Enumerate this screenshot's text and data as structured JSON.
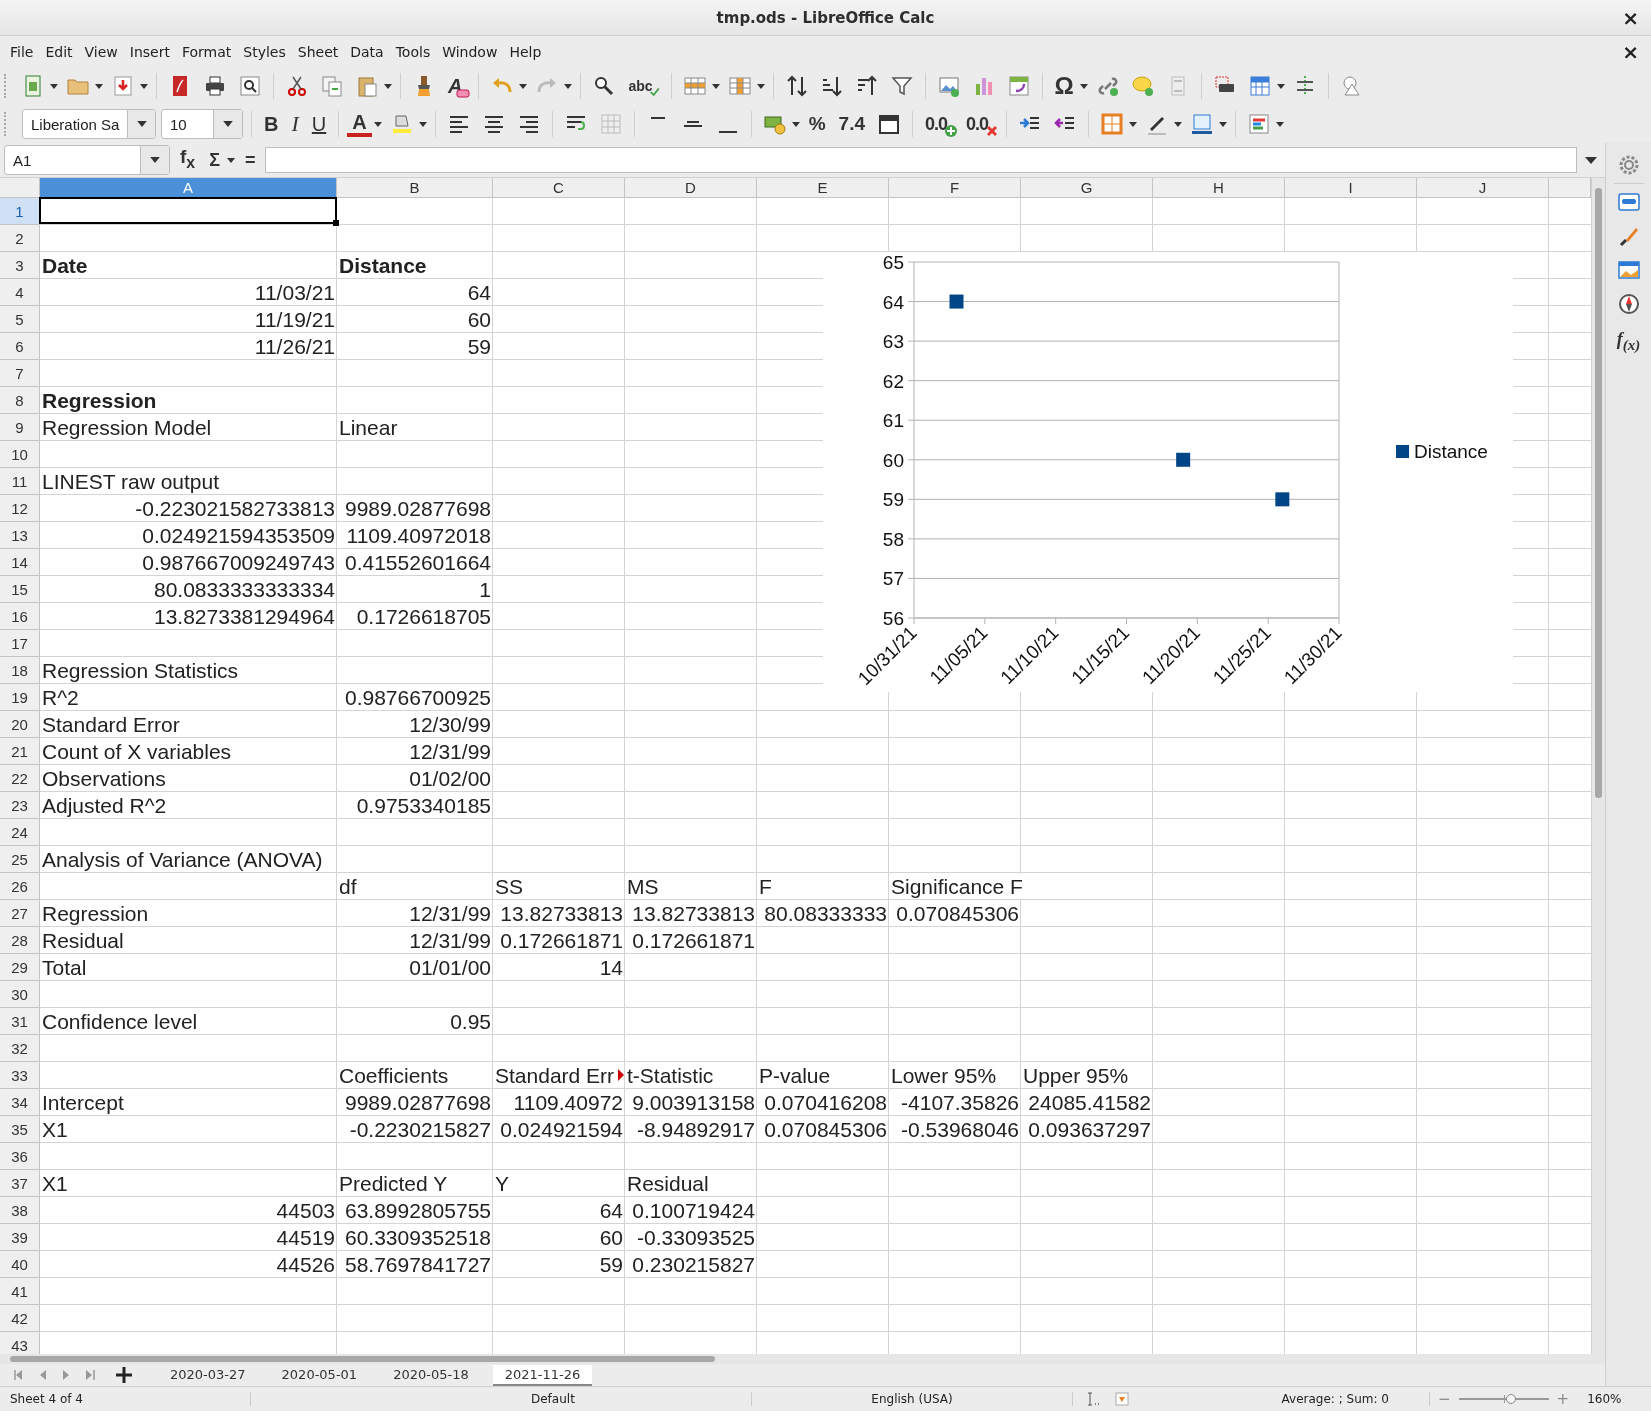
{
  "window": {
    "title": "tmp.ods - LibreOffice Calc",
    "close": "×"
  },
  "menu": {
    "items": [
      "File",
      "Edit",
      "View",
      "Insert",
      "Format",
      "Styles",
      "Sheet",
      "Data",
      "Tools",
      "Window",
      "Help"
    ],
    "close": "×"
  },
  "standard_toolbar": {
    "clear_formatting": "A",
    "spelling": "abc",
    "special_character": "Ω"
  },
  "formatting_toolbar": {
    "font_name": "Liberation Sa",
    "font_size": "10",
    "bold": "B",
    "italic": "I",
    "underline": "U",
    "font_color": "A",
    "percent": "%",
    "number": "7.4",
    "add_decimal": "0.0",
    "delete_decimal": "0.0"
  },
  "formula_bar": {
    "name_box": "A1",
    "function_wizard": "f$_{x}$",
    "sum": "Σ",
    "equals": "="
  },
  "sheet": {
    "columns": [
      {
        "label": "A",
        "selected": true
      },
      {
        "label": "B",
        "selected": false
      },
      {
        "label": "C",
        "selected": false
      },
      {
        "label": "D",
        "selected": false
      },
      {
        "label": "E",
        "selected": false
      },
      {
        "label": "F",
        "selected": false
      },
      {
        "label": "G",
        "selected": false
      },
      {
        "label": "H",
        "selected": false
      },
      {
        "label": "I",
        "selected": false
      },
      {
        "label": "J",
        "selected": false
      }
    ],
    "rows": [
      {
        "label": "1",
        "selected": true
      },
      {
        "label": "2",
        "selected": false
      },
      {
        "label": "3",
        "selected": false,
        "cells": [
          {
            "text": "Date",
            "kind": "heading"
          },
          {
            "text": "Distance",
            "kind": "heading"
          }
        ]
      },
      {
        "label": "4",
        "selected": false,
        "cells": [
          {
            "text": "11/03/21",
            "kind": "number"
          },
          {
            "text": "64",
            "kind": "number"
          }
        ]
      },
      {
        "label": "5",
        "selected": false,
        "cells": [
          {
            "text": "11/19/21",
            "kind": "number"
          },
          {
            "text": "60",
            "kind": "number"
          }
        ]
      },
      {
        "label": "6",
        "selected": false,
        "cells": [
          {
            "text": "11/26/21",
            "kind": "number"
          },
          {
            "text": "59",
            "kind": "number"
          }
        ]
      },
      {
        "label": "7",
        "selected": false
      },
      {
        "label": "8",
        "selected": false,
        "cells": [
          {
            "text": "Regression",
            "kind": "heading"
          }
        ]
      },
      {
        "label": "9",
        "selected": false,
        "cells": [
          {
            "text": "Regression Model",
            "kind": "text"
          },
          {
            "text": "Linear",
            "kind": "text"
          }
        ]
      },
      {
        "label": "10",
        "selected": false
      },
      {
        "label": "11",
        "selected": false,
        "cells": [
          {
            "text": "LINEST raw output",
            "kind": "text"
          }
        ]
      },
      {
        "label": "12",
        "selected": false,
        "cells": [
          {
            "text": "-0.223021582733813",
            "kind": "number"
          },
          {
            "text": "9989.02877698",
            "kind": "number"
          }
        ]
      },
      {
        "label": "13",
        "selected": false,
        "cells": [
          {
            "text": "0.024921594353509",
            "kind": "number"
          },
          {
            "text": "1109.40972018",
            "kind": "number"
          }
        ]
      },
      {
        "label": "14",
        "selected": false,
        "cells": [
          {
            "text": "0.987667009249743",
            "kind": "number"
          },
          {
            "text": "0.41552601664",
            "kind": "number"
          }
        ]
      },
      {
        "label": "15",
        "selected": false,
        "cells": [
          {
            "text": "80.0833333333334",
            "kind": "number"
          },
          {
            "text": "1",
            "kind": "number"
          }
        ]
      },
      {
        "label": "16",
        "selected": false,
        "cells": [
          {
            "text": "13.8273381294964",
            "kind": "number"
          },
          {
            "text": "0.1726618705",
            "kind": "number"
          }
        ]
      },
      {
        "label": "17",
        "selected": false
      },
      {
        "label": "18",
        "selected": false,
        "cells": [
          {
            "text": "Regression Statistics",
            "kind": "text"
          }
        ]
      },
      {
        "label": "19",
        "selected": false,
        "cells": [
          {
            "text": "R^2",
            "kind": "text"
          },
          {
            "text": "0.98766700925",
            "kind": "number"
          }
        ]
      },
      {
        "label": "20",
        "selected": false,
        "cells": [
          {
            "text": "Standard Error",
            "kind": "text"
          },
          {
            "text": "12/30/99",
            "kind": "number"
          }
        ]
      },
      {
        "label": "21",
        "selected": false,
        "cells": [
          {
            "text": "Count of X variables",
            "kind": "text"
          },
          {
            "text": "12/31/99",
            "kind": "number"
          }
        ]
      },
      {
        "label": "22",
        "selected": false,
        "cells": [
          {
            "text": "Observations",
            "kind": "text"
          },
          {
            "text": "01/02/00",
            "kind": "number"
          }
        ]
      },
      {
        "label": "23",
        "selected": false,
        "cells": [
          {
            "text": "Adjusted R^2",
            "kind": "text"
          },
          {
            "text": "0.9753340185",
            "kind": "number"
          }
        ]
      },
      {
        "label": "24",
        "selected": false
      },
      {
        "label": "25",
        "selected": false,
        "cells": [
          {
            "text": "Analysis of Variance (ANOVA)",
            "kind": "text"
          }
        ]
      },
      {
        "label": "26",
        "selected": false,
        "cells": [
          "",
          {
            "text": "df",
            "kind": "text"
          },
          {
            "text": "SS",
            "kind": "text"
          },
          {
            "text": "MS",
            "kind": "text"
          },
          {
            "text": "F",
            "kind": "text"
          },
          {
            "text": "Significance F",
            "kind": "text"
          }
        ]
      },
      {
        "label": "27",
        "selected": false,
        "cells": [
          {
            "text": "Regression",
            "kind": "text"
          },
          {
            "text": "12/31/99",
            "kind": "number"
          },
          {
            "text": "13.82733813",
            "kind": "number"
          },
          {
            "text": "13.82733813",
            "kind": "number"
          },
          {
            "text": "80.08333333",
            "kind": "number"
          },
          {
            "text": "0.070845306",
            "kind": "number"
          }
        ]
      },
      {
        "label": "28",
        "selected": false,
        "cells": [
          {
            "text": "Residual",
            "kind": "text"
          },
          {
            "text": "12/31/99",
            "kind": "number"
          },
          {
            "text": "0.172661871",
            "kind": "number"
          },
          {
            "text": "0.172661871",
            "kind": "number"
          }
        ]
      },
      {
        "label": "29",
        "selected": false,
        "cells": [
          {
            "text": "Total",
            "kind": "text"
          },
          {
            "text": "01/01/00",
            "kind": "number"
          },
          {
            "text": "14",
            "kind": "number"
          }
        ]
      },
      {
        "label": "30",
        "selected": false
      },
      {
        "label": "31",
        "selected": false,
        "cells": [
          {
            "text": "Confidence level",
            "kind": "text"
          },
          {
            "text": "0.95",
            "kind": "number"
          }
        ]
      },
      {
        "label": "32",
        "selected": false
      },
      {
        "label": "33",
        "selected": false,
        "cells": [
          "",
          {
            "text": "Coefficients",
            "kind": "text"
          },
          {
            "text": "Standard Err",
            "kind": "clipped"
          },
          {
            "text": "t-Statistic",
            "kind": "text"
          },
          {
            "text": "P-value",
            "kind": "text"
          },
          {
            "text": "Lower 95%",
            "kind": "text"
          },
          {
            "text": "Upper 95%",
            "kind": "text"
          }
        ]
      },
      {
        "label": "34",
        "selected": false,
        "cells": [
          {
            "text": "Intercept",
            "kind": "text"
          },
          {
            "text": "9989.02877698",
            "kind": "number"
          },
          {
            "text": "1109.40972",
            "kind": "number"
          },
          {
            "text": "9.003913158",
            "kind": "number"
          },
          {
            "text": "0.070416208",
            "kind": "number"
          },
          {
            "text": "-4107.35826",
            "kind": "number"
          },
          {
            "text": "24085.41582",
            "kind": "number"
          }
        ]
      },
      {
        "label": "35",
        "selected": false,
        "cells": [
          {
            "text": "X1",
            "kind": "text"
          },
          {
            "text": "-0.2230215827",
            "kind": "number"
          },
          {
            "text": "0.024921594",
            "kind": "number"
          },
          {
            "text": "-8.94892917",
            "kind": "number"
          },
          {
            "text": "0.070845306",
            "kind": "number"
          },
          {
            "text": "-0.53968046",
            "kind": "number"
          },
          {
            "text": "0.093637297",
            "kind": "number"
          }
        ]
      },
      {
        "label": "36",
        "selected": false
      },
      {
        "label": "37",
        "selected": false,
        "cells": [
          {
            "text": "X1",
            "kind": "text"
          },
          {
            "text": "Predicted Y",
            "kind": "text"
          },
          {
            "text": "Y",
            "kind": "text"
          },
          {
            "text": "Residual",
            "kind": "text"
          }
        ]
      },
      {
        "label": "38",
        "selected": false,
        "cells": [
          {
            "text": "44503",
            "kind": "number"
          },
          {
            "text": "63.8992805755",
            "kind": "number"
          },
          {
            "text": "64",
            "kind": "number"
          },
          {
            "text": "0.100719424",
            "kind": "number"
          }
        ]
      },
      {
        "label": "39",
        "selected": false,
        "cells": [
          {
            "text": "44519",
            "kind": "number"
          },
          {
            "text": "60.3309352518",
            "kind": "number"
          },
          {
            "text": "60",
            "kind": "number"
          },
          {
            "text": "-0.33093525",
            "kind": "number"
          }
        ]
      },
      {
        "label": "40",
        "selected": false,
        "cells": [
          {
            "text": "44526",
            "kind": "number"
          },
          {
            "text": "58.7697841727",
            "kind": "number"
          },
          {
            "text": "59",
            "kind": "number"
          },
          {
            "text": "0.230215827",
            "kind": "number"
          }
        ]
      },
      {
        "label": "41",
        "selected": false
      },
      {
        "label": "42",
        "selected": false
      },
      {
        "label": "43",
        "selected": false
      }
    ],
    "chart_data": {
      "type": "scatter",
      "grid": true,
      "categories": [
        "10/31/21",
        null,
        null,
        null,
        null,
        "11/05/21",
        null,
        null,
        null,
        null,
        "11/10/21",
        null,
        null,
        null,
        null,
        "11/15/21",
        null,
        null,
        null,
        null,
        "11/20/21",
        null,
        null,
        null,
        null,
        "11/25/21",
        null,
        null,
        null,
        null,
        "11/30/21"
      ],
      "ylim": [
        56,
        65
      ],
      "yticks": [
        56,
        57,
        58,
        59,
        60,
        61,
        62,
        63,
        64,
        65
      ],
      "series": [
        {
          "name": "Distance",
          "color": "#004586",
          "values": [
            null,
            null,
            null,
            64,
            null,
            null,
            null,
            null,
            null,
            null,
            null,
            null,
            null,
            null,
            null,
            null,
            null,
            null,
            null,
            60,
            null,
            null,
            null,
            null,
            null,
            null,
            59,
            null,
            null,
            null,
            null
          ]
        }
      ]
    }
  },
  "sidebar": {
    "functions": "f$_{(x)}$"
  },
  "sheet_tabs": [
    {
      "label": "2020-03-27",
      "selected": false
    },
    {
      "label": "2020-05-01",
      "selected": false
    },
    {
      "label": "2020-05-18",
      "selected": false
    },
    {
      "label": "2021-11-26",
      "selected": true
    }
  ],
  "status_bar": {
    "sheet": "Sheet 4 of 4",
    "page_style": "Default",
    "language": "English (USA)",
    "summary": "Average: ; Sum: 0",
    "zoom_out": "−",
    "zoom_in": "+",
    "zoom": {
      "level": 0.58
    },
    "zoom_value": "160%"
  }
}
